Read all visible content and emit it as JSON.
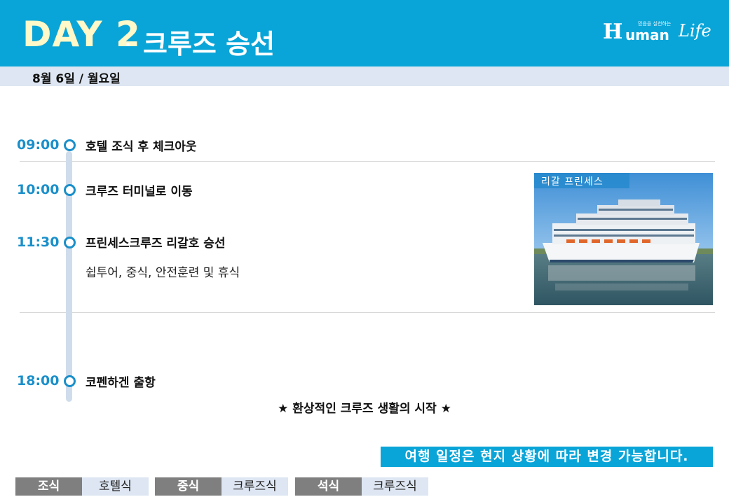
{
  "header": {
    "day": "DAY 2",
    "day_dot": ".",
    "title": "크루즈 승선",
    "logo": {
      "h": "H",
      "uman": "uman",
      "life": "Life",
      "tagline": "믿음을 실천하는"
    }
  },
  "date": "8월 6일 / 월요일",
  "schedule": [
    {
      "time": "09:00",
      "event": "호텔 조식 후 체크아웃"
    },
    {
      "time": "10:00",
      "event": "크루즈 터미널로 이동"
    },
    {
      "time": "11:30",
      "event": "프린세스크루즈 리갈호 승선",
      "detail": "쉽투어, 중식, 안전훈련 및 휴식"
    },
    {
      "time": "18:00",
      "event": "코펜하겐 출항"
    }
  ],
  "photo": {
    "label": "리갈 프린세스"
  },
  "slogan": "★ 환상적인 크루즈 생활의 시작 ★",
  "notice": "여행 일정은 현지 상황에 따라 변경 가능합니다.",
  "meals": [
    {
      "label": "조식",
      "value": "호텔식"
    },
    {
      "label": "중식",
      "value": "크루즈식"
    },
    {
      "label": "석식",
      "value": "크루즈식"
    }
  ],
  "colors": {
    "header": "#0aa5d8",
    "accent": "#1a8fca",
    "datebar": "#dde6f2",
    "meal_label": "#7f7f7f"
  }
}
